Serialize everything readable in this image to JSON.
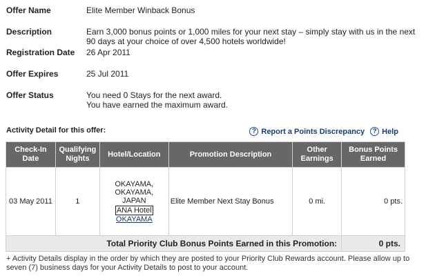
{
  "offer": {
    "name_label": "Offer Name",
    "name_value": "Elite Member Winback Bonus",
    "description_label": "Description",
    "description_value": "Earn 3,000 bonus points or 1,000 miles for your next stay – simply stay with us in the next 90 days at your choice of over 4,500 hotels worldwide!",
    "registration_label": "Registration Date",
    "registration_value": "26 Apr 2011",
    "expires_label": "Offer Expires",
    "expires_value": "25 Jul 2011",
    "status_label": "Offer Status",
    "status_line1": "You need 0 Stays for the next award.",
    "status_line2": "You have earned the maximum award."
  },
  "activity": {
    "title": "Activity Detail for this offer:",
    "report_link": "Report a Points Discrepancy",
    "help_link": "Help",
    "columns": {
      "check_in": "Check-In Date",
      "nights": "Qualifying Nights",
      "hotel": "Hotel/Location",
      "promo": "Promotion Description",
      "other": "Other Earnings",
      "bonus": "Bonus Points Earned"
    },
    "rows": [
      {
        "date": "03 May 2011",
        "nights": "1",
        "hotel_line1": "OKAYAMA,",
        "hotel_line2": "OKAYAMA,",
        "hotel_line3": "JAPAN",
        "hotel_name": "ANA Hotel",
        "hotel_link": "OKAYAMA",
        "promo": "Elite Member Next Stay Bonus",
        "other": "0 mi.",
        "bonus": "0 pts."
      }
    ],
    "total_label": "Total Priority Club Bonus Points Earned in this Promotion:",
    "total_value": "0 pts."
  },
  "footnote": "+ Activity Details display in the order by which they are posted to your Priority Club Rewards account. Please allow up to seven (7) business days for your Activity Details to post to your account.",
  "colors": {
    "header_bg": "#676767",
    "total_bg": "#e9e9e9",
    "link": "#1a3d6e"
  }
}
